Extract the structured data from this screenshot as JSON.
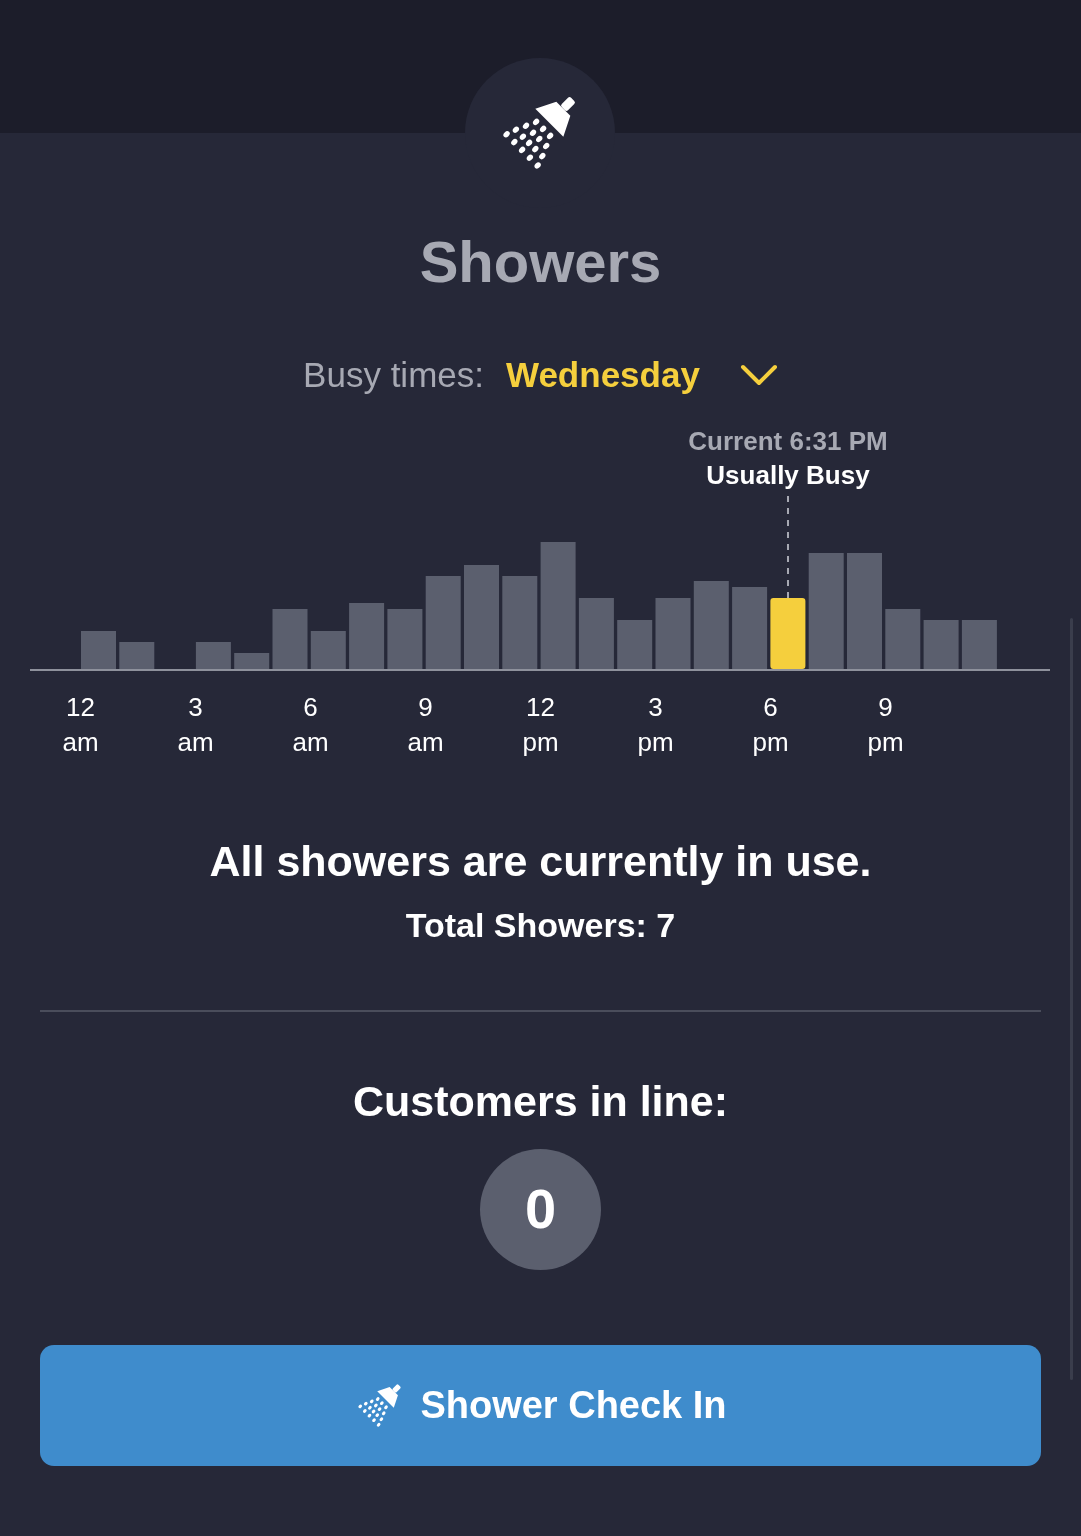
{
  "title": "Showers",
  "busy_times": {
    "label": "Busy times:",
    "day": "Wednesday"
  },
  "chart_annotation": {
    "time": "Current 6:31 PM",
    "status": "Usually Busy"
  },
  "x_labels": [
    {
      "hour": "12",
      "period": "am"
    },
    {
      "hour": "3",
      "period": "am"
    },
    {
      "hour": "6",
      "period": "am"
    },
    {
      "hour": "9",
      "period": "am"
    },
    {
      "hour": "12",
      "period": "pm"
    },
    {
      "hour": "3",
      "period": "pm"
    },
    {
      "hour": "6",
      "period": "pm"
    },
    {
      "hour": "9",
      "period": "pm"
    }
  ],
  "status_message": "All showers are currently in use.",
  "total_showers": "Total Showers: 7",
  "queue": {
    "label": "Customers in line:",
    "count": "0"
  },
  "check_in_button": "Shower Check In"
}
